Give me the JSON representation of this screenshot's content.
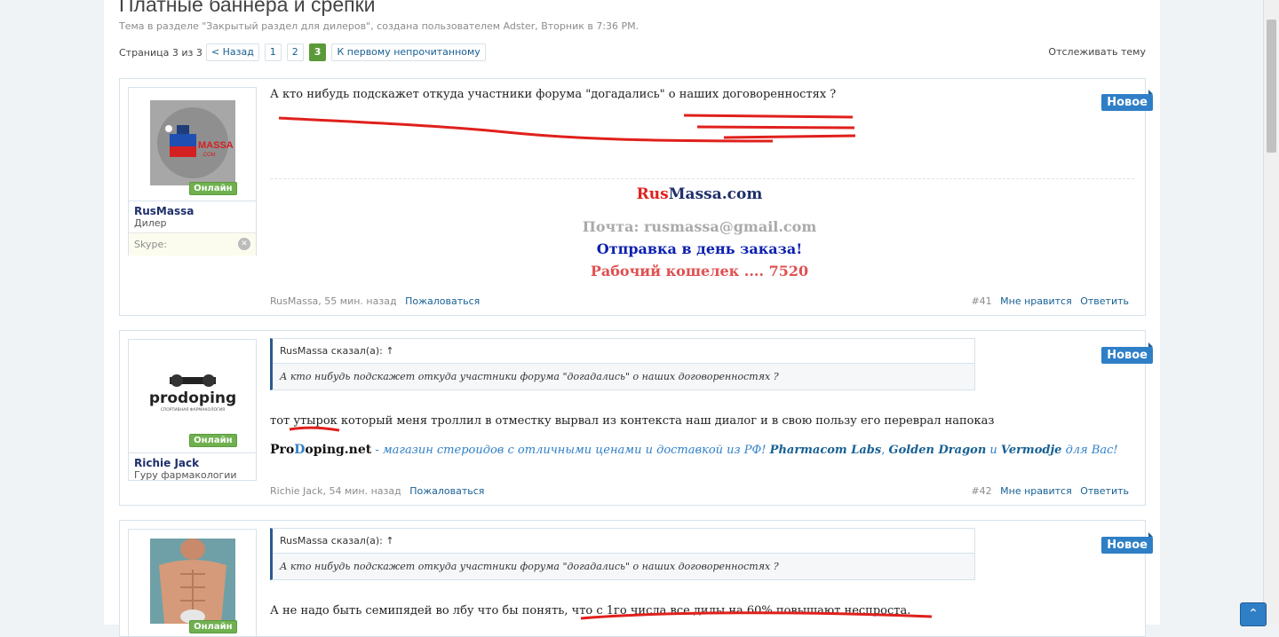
{
  "thread": {
    "title": "Платные баннера и срепки",
    "meta": "Тема в разделе \"Закрытый раздел для дилеров\", создана пользователем Adster, Вторник в 7:36 PM.",
    "pager_label": "Страница 3 из 3",
    "prev": "< Назад",
    "pages": [
      "1",
      "2",
      "3"
    ],
    "first_unread": "К первому непрочитанному",
    "watch": "Отслеживать тему"
  },
  "badge_new": "Новое",
  "online": "Онлайн",
  "posts": [
    {
      "user": "RusMassa",
      "user_title": "Дилер",
      "skype": "Skype:",
      "message": "А кто нибудь подскажет откуда участники форума \"догадались\" о наших договоренностях ?",
      "sig_site_a": "Rus",
      "sig_site_b": "Massa.com",
      "sig_mail": "Почта: rusmassa@gmail.com",
      "sig_ship": "Отправка в день заказа!",
      "sig_wallet": "Рабочий кошелек .... 7520",
      "author": "RusMassa",
      "time": "55 мин. назад",
      "report": "Пожаловаться",
      "num": "#41",
      "like": "Мне нравится",
      "reply": "Ответить",
      "colors": {
        "red": "#e0201c",
        "blue": "#1f2f6a",
        "gray": "#aaaaaa",
        "ship": "#0b1fb0",
        "wallet": "#e05050"
      }
    },
    {
      "user": "Richie Jack",
      "user_title": "Гуру фармакологии",
      "quote_head": "RusMassa сказал(а): ↑",
      "quote_body": "А кто нибудь подскажет откуда участники форума \"догадались\" о наших договоренностях ?",
      "message": "тот утырок который меня троллил в отместку вырвал из контекста наш диалог и в свою пользу его переврал напоказ",
      "sig_brand_a": "Pro",
      "sig_brand_b": "D",
      "sig_brand_c": "oping.net",
      "sig_text1": " - магазин стероидов с отличными ценами и доставкой из РФ! ",
      "sig_b1": "Pharmacom Labs",
      "sig_sep1": ", ",
      "sig_b2": "Golden Dragon",
      "sig_and": " и ",
      "sig_b3": "Vermodje",
      "sig_text2": " для Вас!",
      "author": "Richie Jack",
      "time": "54 мин. назад",
      "report": "Пожаловаться",
      "num": "#42",
      "like": "Мне нравится",
      "reply": "Ответить",
      "logo_text": "prodoping",
      "logo_sub": "СПОРТИВНАЯ ФАРМАКОЛОГИЯ"
    },
    {
      "quote_head": "RusMassa сказал(а): ↑",
      "quote_body": "А кто нибудь подскажет откуда участники форума \"догадались\" о наших договоренностях ?",
      "message": "А не надо быть семипядей во лбу что бы понять, что с 1го числа все дилы на 60% повышают неспроста."
    }
  ],
  "icons": {
    "skype": "skype-icon",
    "totop": "chevron-up-double-icon"
  }
}
